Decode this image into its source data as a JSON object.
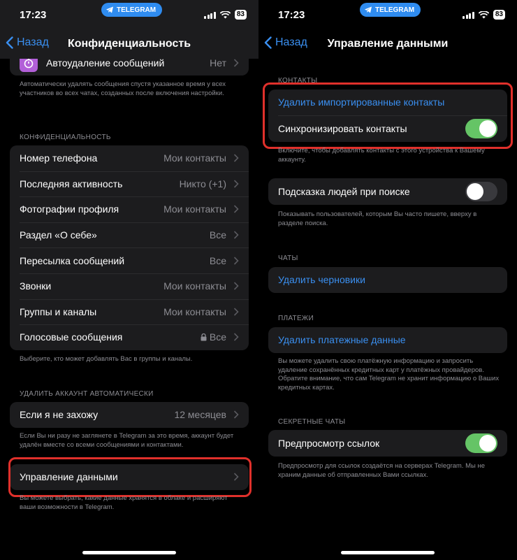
{
  "status": {
    "time": "17:23",
    "telegram_pill": "TELEGRAM",
    "battery": "83"
  },
  "left": {
    "nav": {
      "back": "Назад",
      "title": "Конфиденциальность"
    },
    "top_row": {
      "label": "Автоудаление сообщений",
      "value": "Нет"
    },
    "top_footnote": "Автоматически удалять сообщения спустя указанное время у всех участников во всех чатах, созданных после включения настройки.",
    "privacy_header": "КОНФИДЕНЦИАЛЬНОСТЬ",
    "privacy_rows": [
      {
        "label": "Номер телефона",
        "value": "Мои контакты"
      },
      {
        "label": "Последняя активность",
        "value": "Никто (+1)"
      },
      {
        "label": "Фотографии профиля",
        "value": "Мои контакты"
      },
      {
        "label": "Раздел «О себе»",
        "value": "Все"
      },
      {
        "label": "Пересылка сообщений",
        "value": "Все"
      },
      {
        "label": "Звонки",
        "value": "Мои контакты"
      },
      {
        "label": "Группы и каналы",
        "value": "Мои контакты"
      },
      {
        "label": "Голосовые сообщения",
        "value": "Все"
      }
    ],
    "privacy_footnote": "Выберите, кто может добавлять Вас в группы и каналы.",
    "delete_header": "УДАЛИТЬ АККАУНТ АВТОМАТИЧЕСКИ",
    "delete_row": {
      "label": "Если я не захожу",
      "value": "12 месяцев"
    },
    "delete_footnote": "Если Вы ни разу не заглянете в Telegram за это время, аккаунт будет удалён вместе со всеми сообщениями и контактами.",
    "data_row": {
      "label": "Управление данными"
    },
    "data_footnote": "Вы можете выбрать, какие данные хранятся в облаке и расширяют ваши возможности в Telegram."
  },
  "right": {
    "nav": {
      "back": "Назад",
      "title": "Управление данными"
    },
    "contacts_header": "КОНТАКТЫ",
    "delete_imported": "Удалить импортированные контакты",
    "sync_contacts": "Синхронизировать контакты",
    "sync_footnote": "Включите, чтобы добавлять контакты с этого устройства к Вашему аккаунту.",
    "suggest_people": "Подсказка людей при поиске",
    "suggest_footnote": "Показывать пользователей, которым Вы часто пишете, вверху в разделе поиска.",
    "chats_header": "ЧАТЫ",
    "delete_drafts": "Удалить черновики",
    "payments_header": "ПЛАТЕЖИ",
    "delete_payment": "Удалить платежные данные",
    "payment_footnote": "Вы можете удалить свою платёжную информацию и запросить удаление сохранённых кредитных карт у платёжных провайдеров. Обратите внимание, что сам Telegram не хранит информацию о Ваших кредитных картах.",
    "secret_header": "СЕКРЕТНЫЕ ЧАТЫ",
    "link_preview": "Предпросмотр ссылок",
    "link_footnote": "Предпросмотр для ссылок создаётся на серверах Telegram. Мы не храним данные об отправленных Вами ссылках.",
    "toggles": {
      "sync_contacts": true,
      "suggest_people": false,
      "link_preview": true
    }
  },
  "colors": {
    "accent": "#3a8ff0",
    "toggle_on": "#65c466",
    "highlight": "#e0302b",
    "cell": "#1c1c1e"
  }
}
